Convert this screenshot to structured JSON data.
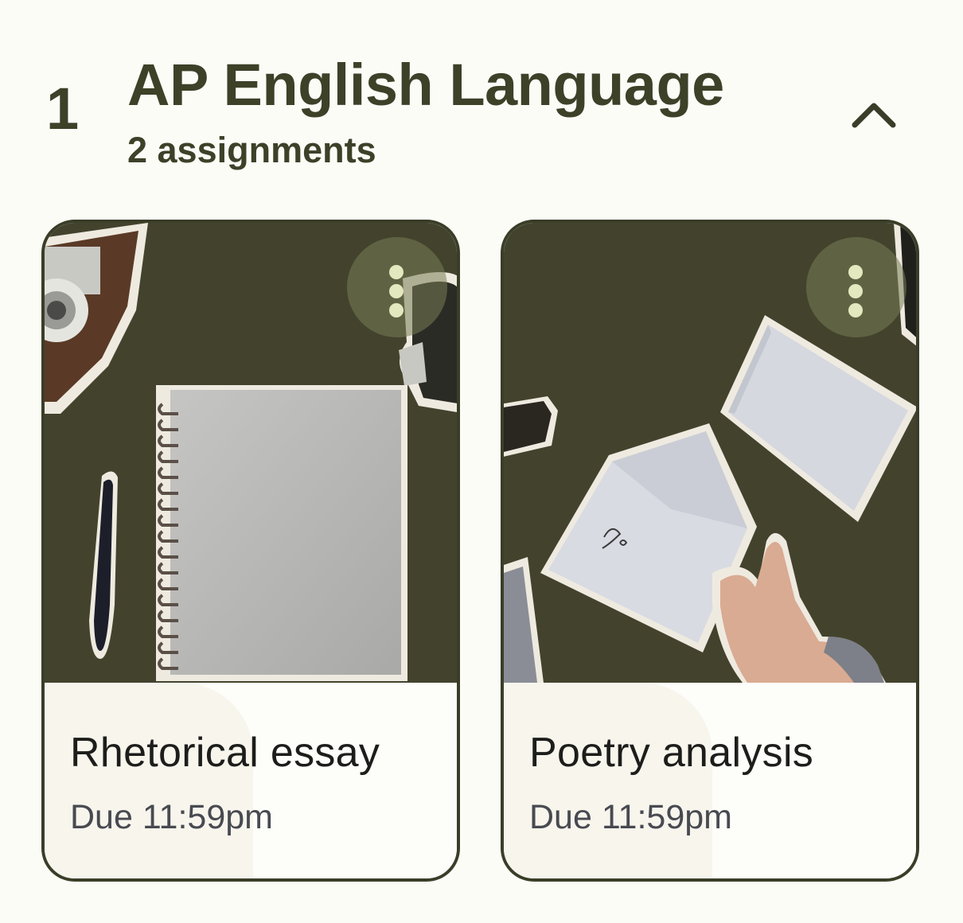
{
  "section": {
    "number": "1",
    "title": "AP English Language",
    "subtitle": "2 assignments",
    "collapse_icon": "chevron-up-icon"
  },
  "assignments": [
    {
      "title": "Rhetorical essay",
      "due": "Due 11:59pm",
      "image_icon": "notebook-illustration",
      "menu_icon": "more-vertical-icon"
    },
    {
      "title": "Poetry analysis",
      "due": "Due 11:59pm",
      "image_icon": "envelope-illustration",
      "menu_icon": "more-vertical-icon"
    }
  ],
  "colors": {
    "primary": "#3c4128",
    "card_image_bg": "#43432d",
    "card_bg": "#fdfdf9",
    "page_bg": "#fcfcf7",
    "accent_dot": "#e4e8bf"
  }
}
